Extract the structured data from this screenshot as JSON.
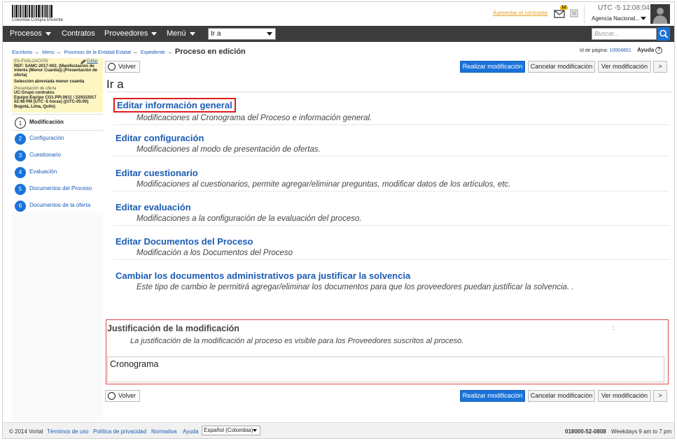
{
  "header": {
    "logo_text": "Colombia Compra Eficiente",
    "increase_contrast": "Aumentar el contraste",
    "mail_count": "12",
    "utc_label": "UTC -5",
    "time": "12:08:04",
    "agency": "Agencia Nacional..."
  },
  "nav": {
    "items": [
      "Procesos",
      "Contratos",
      "Proveedores",
      "Menú"
    ],
    "goto_value": "Ir a",
    "search_placeholder": "Buscar..."
  },
  "breadcrumb": {
    "items": [
      "Escritorio",
      "Menú",
      "Procesos de la Entidad Estatal",
      "Expediente"
    ],
    "current": "Proceso en edición"
  },
  "page_id": {
    "label": "Id de página:",
    "value": "10004801"
  },
  "help": "Ayuda",
  "process": {
    "status": "EN EVALUACIÓN",
    "edit": "Editar",
    "ref": "REF: SAMC-2017-002. (Manifestación de interés (Menor Cuantía)) (Presentación de oferta)",
    "type": "Selección abreviada menor cuantía",
    "phase": "Presentación de oferta",
    "team": "UC:Grupo contratos",
    "equipo": "Equipo:Equipo CO1.PPI.0611 / 22/02/2017 02:48 PM (UTC -5 horas) ((UTC-05:00) Bogotá, Lima, Quito)"
  },
  "steps": [
    {
      "num": "1",
      "label": "Modificación"
    },
    {
      "num": "2",
      "label": "Configuración"
    },
    {
      "num": "3",
      "label": "Cuestionario"
    },
    {
      "num": "4",
      "label": "Evaluación"
    },
    {
      "num": "5",
      "label": "Documentos del Proceso"
    },
    {
      "num": "6",
      "label": "Documentos de la oferta"
    }
  ],
  "buttons": {
    "back": "Volver",
    "make": "Realizar modificación",
    "cancel": "Cancelar modificación",
    "view": "Ver modificación",
    "next": ">"
  },
  "main": {
    "title": "Ir a",
    "options": [
      {
        "title": "Editar información general",
        "desc": "Modificaciones al Cronograma del Proceso e información general."
      },
      {
        "title": "Editar configuración",
        "desc": "Modificaciones al modo de presentación de ofertas."
      },
      {
        "title": "Editar cuestionario",
        "desc": "Modificaciones al cuestionarios, permite agregar/eliminar preguntas, modificar datos de los artículos, etc."
      },
      {
        "title": "Editar evaluación",
        "desc": "Modificaciones a la configuración de la evaluación del proceso."
      },
      {
        "title": "Editar Documentos del Proceso",
        "desc": "Modificación a los Documentos del Proceso"
      },
      {
        "title": "Cambiar los documentos administrativos para justificar la solvencia",
        "desc": "Este tipo de cambio le permitirá agregar/eliminar los documentos para que los proveedores puedan justificar la solvencia. ."
      }
    ]
  },
  "justification": {
    "title": "Justificación de la modificación",
    "colon": ":",
    "desc": "La justificación de la modificación al proceso es visible para los Proveedores suscritos al proceso.",
    "value": "Cronograma"
  },
  "footer": {
    "copyright": "© 2014 Vortal",
    "terms": "Términos de uso",
    "privacy": "Política de privacidad",
    "rules": "Normativa",
    "help": "Ayuda",
    "language": "Español (Colombia)",
    "phone": "018000-52-0808",
    "hours": "Weekdays 9 am to 7 pm"
  }
}
